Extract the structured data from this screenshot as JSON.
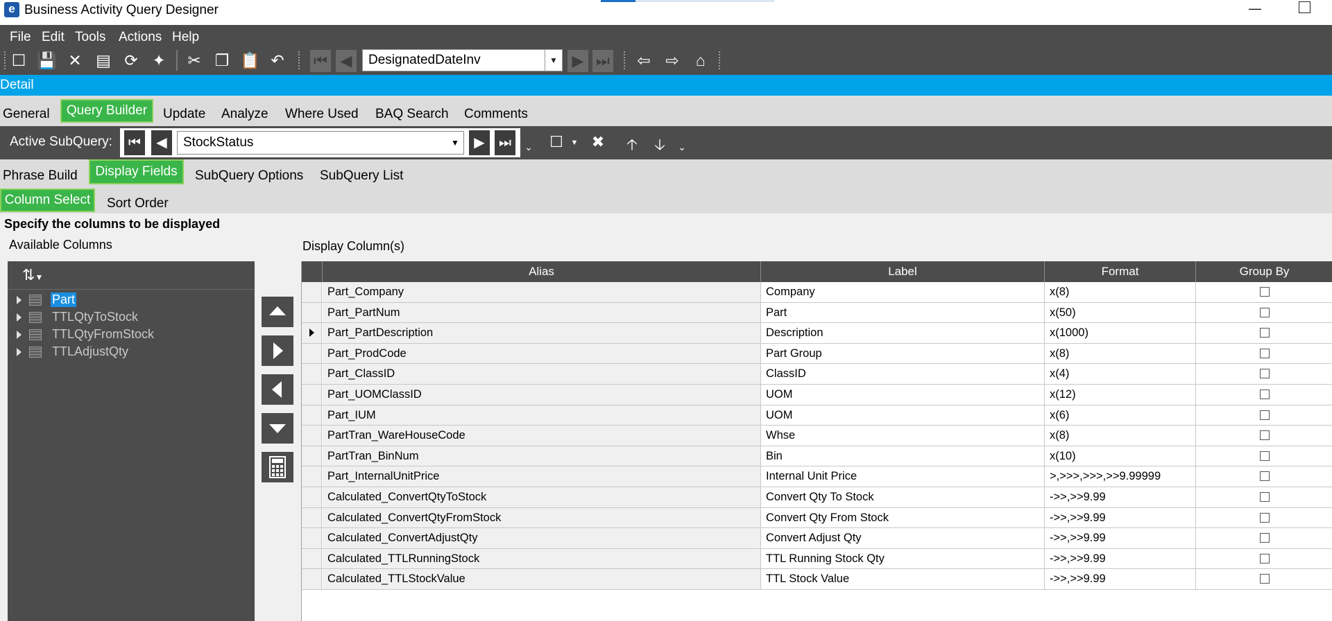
{
  "window": {
    "title": "Business Activity Query Designer",
    "logo_letter": "e"
  },
  "menu": [
    "File",
    "Edit",
    "Tools",
    "Actions",
    "Help"
  ],
  "toolbar": {
    "query_id": "DesignatedDateInv"
  },
  "detail_bar": {
    "label": "Detail"
  },
  "main_tabs": {
    "general": "General",
    "query_builder": "Query Builder",
    "update": "Update",
    "analyze": "Analyze",
    "where_used": "Where Used",
    "baq_search": "BAQ Search",
    "comments": "Comments"
  },
  "subquery": {
    "label": "Active SubQuery:",
    "value": "StockStatus"
  },
  "sub_tabs": {
    "phrase_build": "Phrase Build",
    "display_fields": "Display Fields",
    "subquery_options": "SubQuery Options",
    "subquery_list": "SubQuery List"
  },
  "inner_tabs": {
    "column_select": "Column Select",
    "sort_order": "Sort Order"
  },
  "content": {
    "instructions": "Specify the columns to be displayed",
    "available_label": "Available Columns",
    "display_label": "Display Column(s)"
  },
  "available_columns": [
    "Part",
    "TTLQtyToStock",
    "TTLQtyFromStock",
    "TTLAdjustQty"
  ],
  "grid": {
    "headers": {
      "alias": "Alias",
      "label": "Label",
      "format": "Format",
      "group_by": "Group By"
    },
    "rows": [
      {
        "alias": "Part_Company",
        "label": "Company",
        "format": "x(8)"
      },
      {
        "alias": "Part_PartNum",
        "label": "Part",
        "format": "x(50)"
      },
      {
        "alias": "Part_PartDescription",
        "label": "Description",
        "format": "x(1000)"
      },
      {
        "alias": "Part_ProdCode",
        "label": "Part Group",
        "format": "x(8)"
      },
      {
        "alias": "Part_ClassID",
        "label": "ClassID",
        "format": "x(4)"
      },
      {
        "alias": "Part_UOMClassID",
        "label": "UOM",
        "format": "x(12)"
      },
      {
        "alias": "Part_IUM",
        "label": "UOM",
        "format": "x(6)"
      },
      {
        "alias": "PartTran_WareHouseCode",
        "label": "Whse",
        "format": "x(8)"
      },
      {
        "alias": "PartTran_BinNum",
        "label": "Bin",
        "format": "x(10)"
      },
      {
        "alias": "Part_InternalUnitPrice",
        "label": "Internal Unit Price",
        "format": ">,>>>,>>>,>>9.99999"
      },
      {
        "alias": "Calculated_ConvertQtyToStock",
        "label": "Convert Qty To Stock",
        "format": "->>,>>9.99"
      },
      {
        "alias": "Calculated_ConvertQtyFromStock",
        "label": "Convert Qty From Stock",
        "format": "->>,>>9.99"
      },
      {
        "alias": "Calculated_ConvertAdjustQty",
        "label": "Convert Adjust Qty",
        "format": "->>,>>9.99"
      },
      {
        "alias": "Calculated_TTLRunningStock",
        "label": "TTL Running Stock Qty",
        "format": "->>,>>9.99"
      },
      {
        "alias": "Calculated_TTLStockValue",
        "label": "TTL Stock Value",
        "format": "->>,>>9.99"
      }
    ]
  },
  "colors": {
    "accent_green": "#3ab54a",
    "detail_blue": "#00a3e8",
    "dark_bar": "#4c4c4c",
    "selection_blue": "#1a8fe0"
  }
}
